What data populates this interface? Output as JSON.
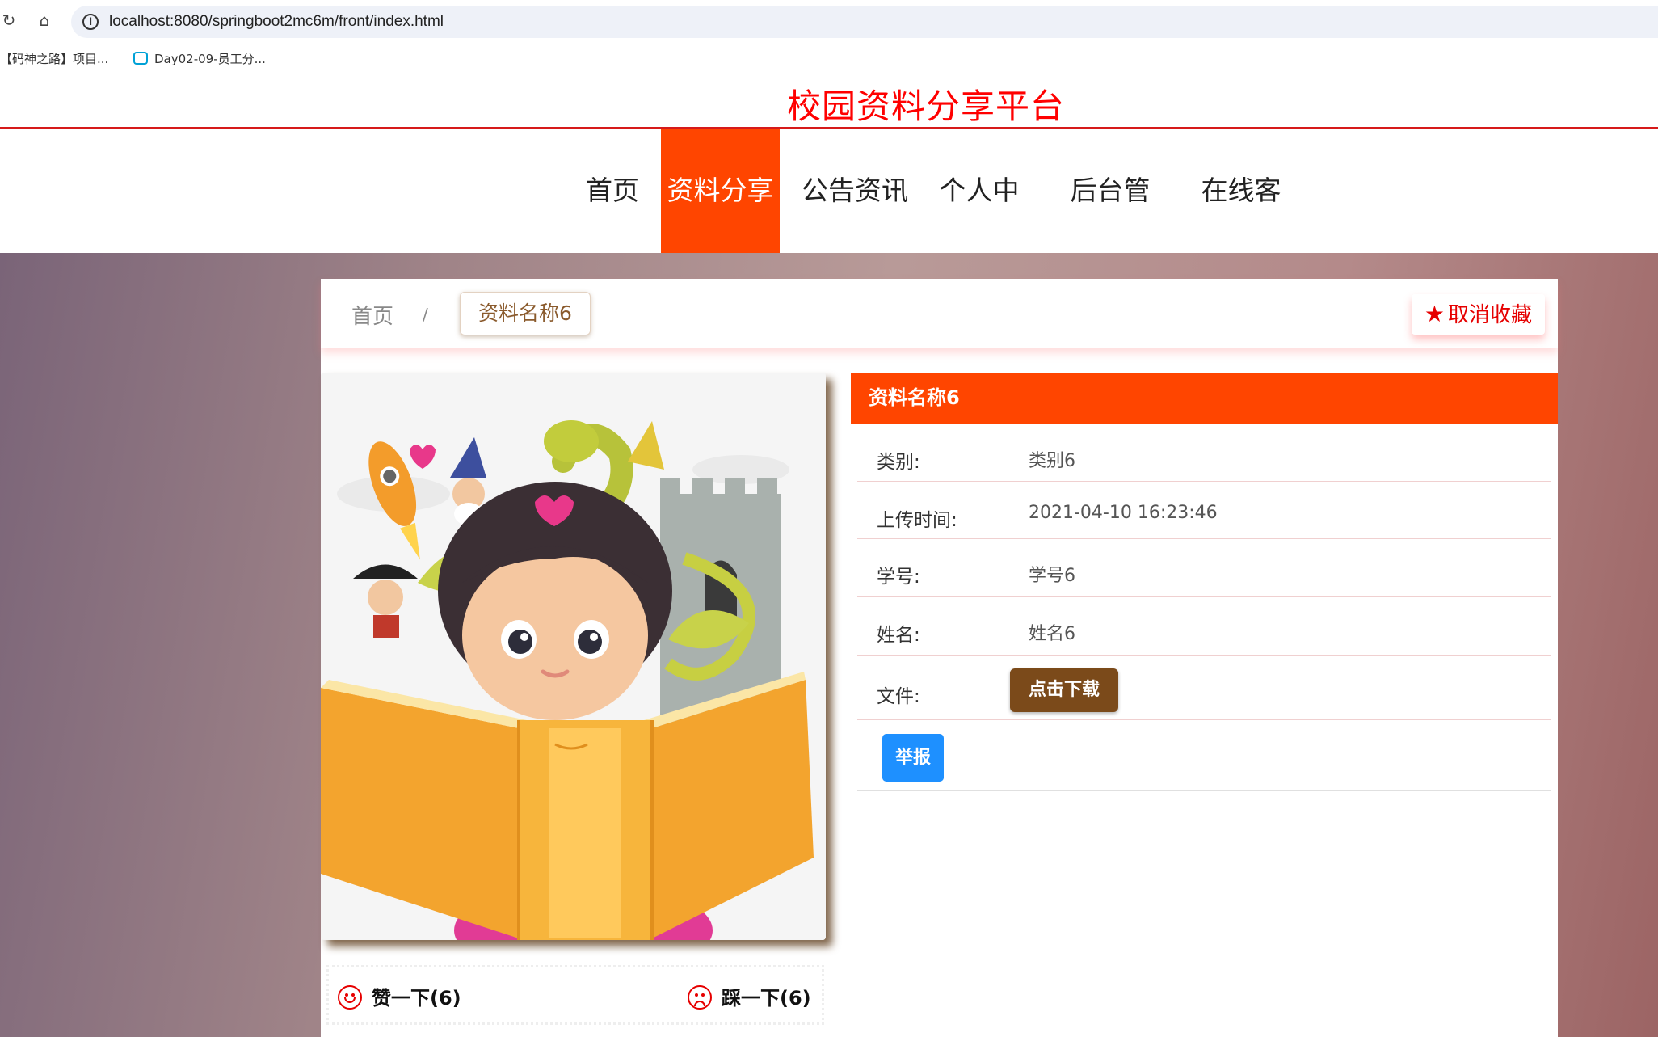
{
  "browser": {
    "url": "localhost:8080/springboot2mc6m/front/index.html",
    "bookmarks": [
      "【码神之路】项目...",
      "Day02-09-员工分..."
    ]
  },
  "site": {
    "title": "校园资料分享平台",
    "nav": [
      "首页",
      "资料分享",
      "公告资讯",
      "个人中心",
      "后台管理",
      "在线客服"
    ],
    "active_nav": "资料分享"
  },
  "breadcrumb": {
    "home": "首页",
    "separator": "/",
    "current": "资料名称6"
  },
  "favorite": {
    "label": "取消收藏",
    "icon": "star-icon"
  },
  "detail": {
    "title": "资料名称6",
    "category_label": "类别:",
    "category": "类别6",
    "upload_time_label": "上传时间:",
    "upload_time": "2021-04-10 16:23:46",
    "student_id_label": "学号:",
    "student_id": "学号6",
    "name_label": "姓名:",
    "name": "姓名6",
    "file_label": "文件:",
    "download_label": "点击下载",
    "report_label": "举报"
  },
  "votes": {
    "like_label": "赞一下(6)",
    "dislike_label": "踩一下(6)"
  },
  "colors": {
    "accent": "#ff4500",
    "title_red": "#ff0000",
    "download_brown": "#7b4a1a",
    "report_blue": "#1e90ff"
  }
}
